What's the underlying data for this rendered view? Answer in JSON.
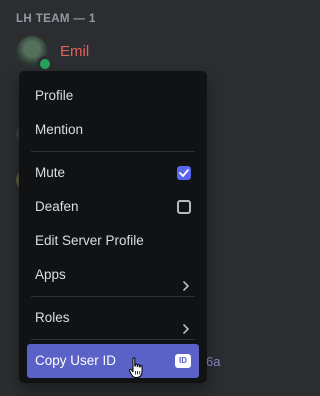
{
  "member_list": {
    "section_header": "LH TEAM — 1",
    "member": {
      "name": "Emil",
      "name_color": "#e0625c",
      "status": "online"
    }
  },
  "context_menu": {
    "items": [
      {
        "label": "Profile"
      },
      {
        "label": "Mention"
      },
      {
        "label": "Mute",
        "checked": true
      },
      {
        "label": "Deafen",
        "checked": false
      },
      {
        "label": "Edit Server Profile"
      },
      {
        "label": "Apps",
        "icon": "chevron-right-icon"
      },
      {
        "label": "Roles",
        "icon": "chevron-right-icon"
      },
      {
        "label": "Copy User ID",
        "icon": "id-icon",
        "badge": "ID",
        "highlighted": true
      }
    ]
  },
  "background_partial_text": "6a",
  "colors": {
    "menu_bg": "#111214",
    "highlight": "#5b62c7",
    "checkbox_checked": "#5865f2",
    "app_bg": "#2b2d31"
  }
}
